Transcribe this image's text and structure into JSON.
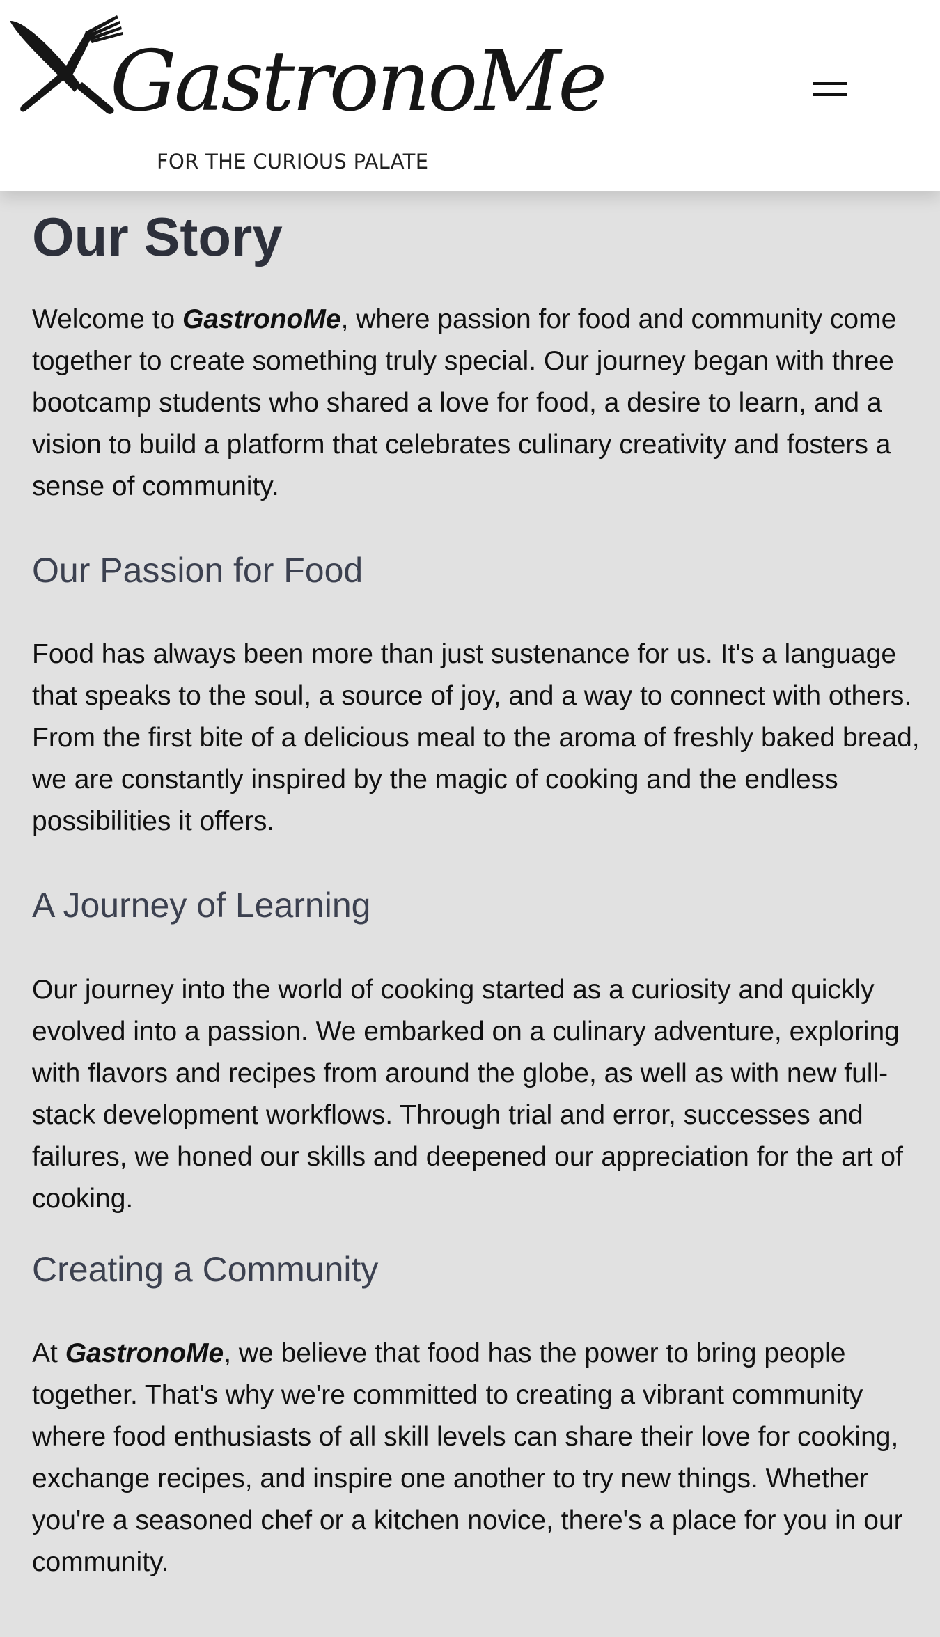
{
  "header": {
    "logo": {
      "wordmark": "GastronoMe",
      "tagline": "FOR THE CURIOUS PALATE",
      "mark_icon": "crossed-knife-fork-icon"
    },
    "menu_icon": "hamburger-menu-icon"
  },
  "story": {
    "title": "Our Story",
    "intro": {
      "pre": "Welcome to ",
      "brand": "GastronoMe",
      "post": ", where passion for food and community come together to create something truly special. Our journey began with three bootcamp students who shared a love for food, a desire to learn, and a vision to build a platform that celebrates culinary creativity and fosters a sense of community."
    },
    "sections": [
      {
        "heading": "Our Passion for Food",
        "text": "Food has always been more than just sustenance for us. It's a language that speaks to the soul, a source of joy, and a way to connect with others. From the first bite of a delicious meal to the aroma of freshly baked bread, we are constantly inspired by the magic of cooking and the endless possibilities it offers."
      },
      {
        "heading": "A Journey of Learning",
        "text": "Our journey into the world of cooking started as a curiosity and quickly evolved into a passion. We embarked on a culinary adventure, exploring with flavors and recipes from around the globe, as well as with new full-stack development workflows. Through trial and error, successes and failures, we honed our skills and deepened our appreciation for the art of cooking."
      },
      {
        "heading": "Creating a Community",
        "pre": "At ",
        "brand": "GastronoMe",
        "post": ", we believe that food has the power to bring people together. That's why we're committed to creating a vibrant community where food enthusiasts of all skill levels can share their love for cooking, exchange recipes, and inspire one another to try new things. Whether you're a seasoned chef or a kitchen novice, there's a place for you in our community."
      }
    ]
  },
  "colors": {
    "page_background": "#e1e1e1",
    "header_background": "#ffffff",
    "title": "#2d303b",
    "heading": "#3c4150",
    "body_text": "#111111"
  }
}
